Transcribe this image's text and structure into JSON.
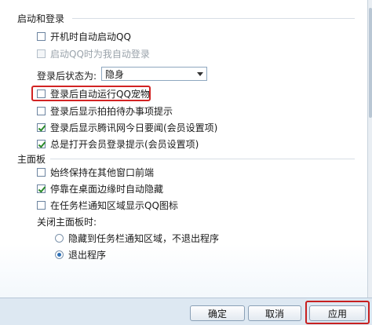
{
  "login_section": {
    "title": "启动和登录",
    "items": [
      {
        "label": "开机时自动启动QQ",
        "checked": false,
        "disabled": false
      },
      {
        "label": "启动QQ时为我自动登录",
        "checked": false,
        "disabled": true
      }
    ],
    "status_label": "登录后状态为:",
    "status_value": "隐身",
    "more_items": [
      {
        "label": "登录后自动运行QQ宠物",
        "checked": false,
        "highlighted": true
      },
      {
        "label": "登录后显示拍拍待办事项提示",
        "checked": false
      },
      {
        "label": "登录后显示腾讯网今日要闻(会员设置项)",
        "checked": true
      },
      {
        "label": "总是打开会员登录提示(会员设置项)",
        "checked": true
      }
    ]
  },
  "main_panel_section": {
    "title": "主面板",
    "items": [
      {
        "label": "始终保持在其他窗口前端",
        "checked": false
      },
      {
        "label": "停靠在桌面边缘时自动隐藏",
        "checked": true
      },
      {
        "label": "在任务栏通知区域显示QQ图标",
        "checked": false
      }
    ],
    "close_label": "关闭主面板时:",
    "close_options": [
      {
        "label": "隐藏到任务栏通知区域，不退出程序",
        "selected": false
      },
      {
        "label": "退出程序",
        "selected": true
      }
    ]
  },
  "footer": {
    "ok_label": "确定",
    "cancel_label": "取消",
    "apply_label": "应用"
  },
  "colors": {
    "highlight": "#d22323",
    "check": "#2a8a2a",
    "footer_bg": "#dde8f2"
  }
}
